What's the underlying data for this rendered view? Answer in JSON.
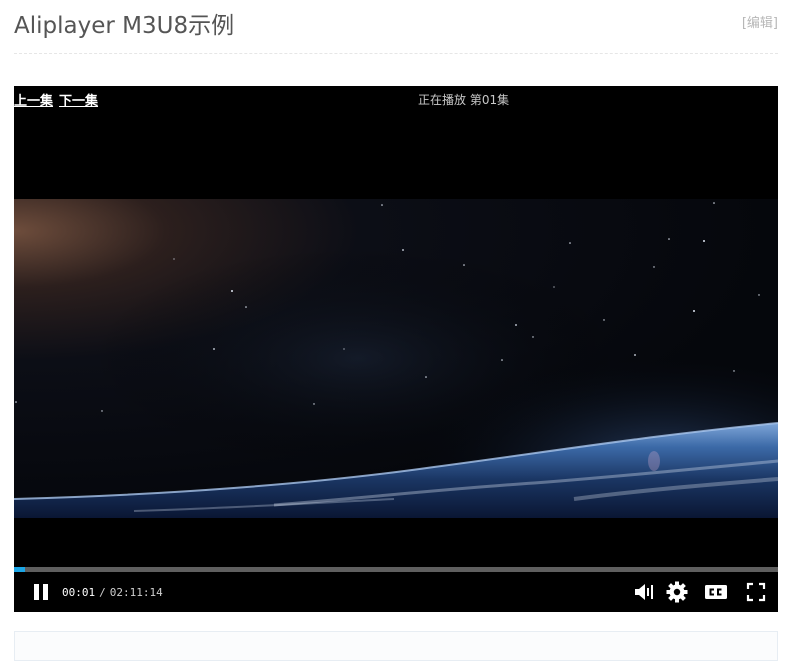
{
  "page": {
    "title": "Aliplayer M3U8示例",
    "edit_link": "[编辑]"
  },
  "player": {
    "prev_episode": "上一集",
    "next_episode": "下一集",
    "now_playing": "正在播放 第01集",
    "time_current": "00:01",
    "time_separator": "/",
    "time_total": "02:11:14",
    "progress_fraction": 0.015,
    "accent_color": "#1ca6e6",
    "controls": {
      "play_state_icon": "pause-icon",
      "volume_icon": "volume-icon",
      "settings_icon": "gear-icon",
      "captions_icon": "cc-icon",
      "fullscreen_icon": "fullscreen-icon"
    }
  }
}
